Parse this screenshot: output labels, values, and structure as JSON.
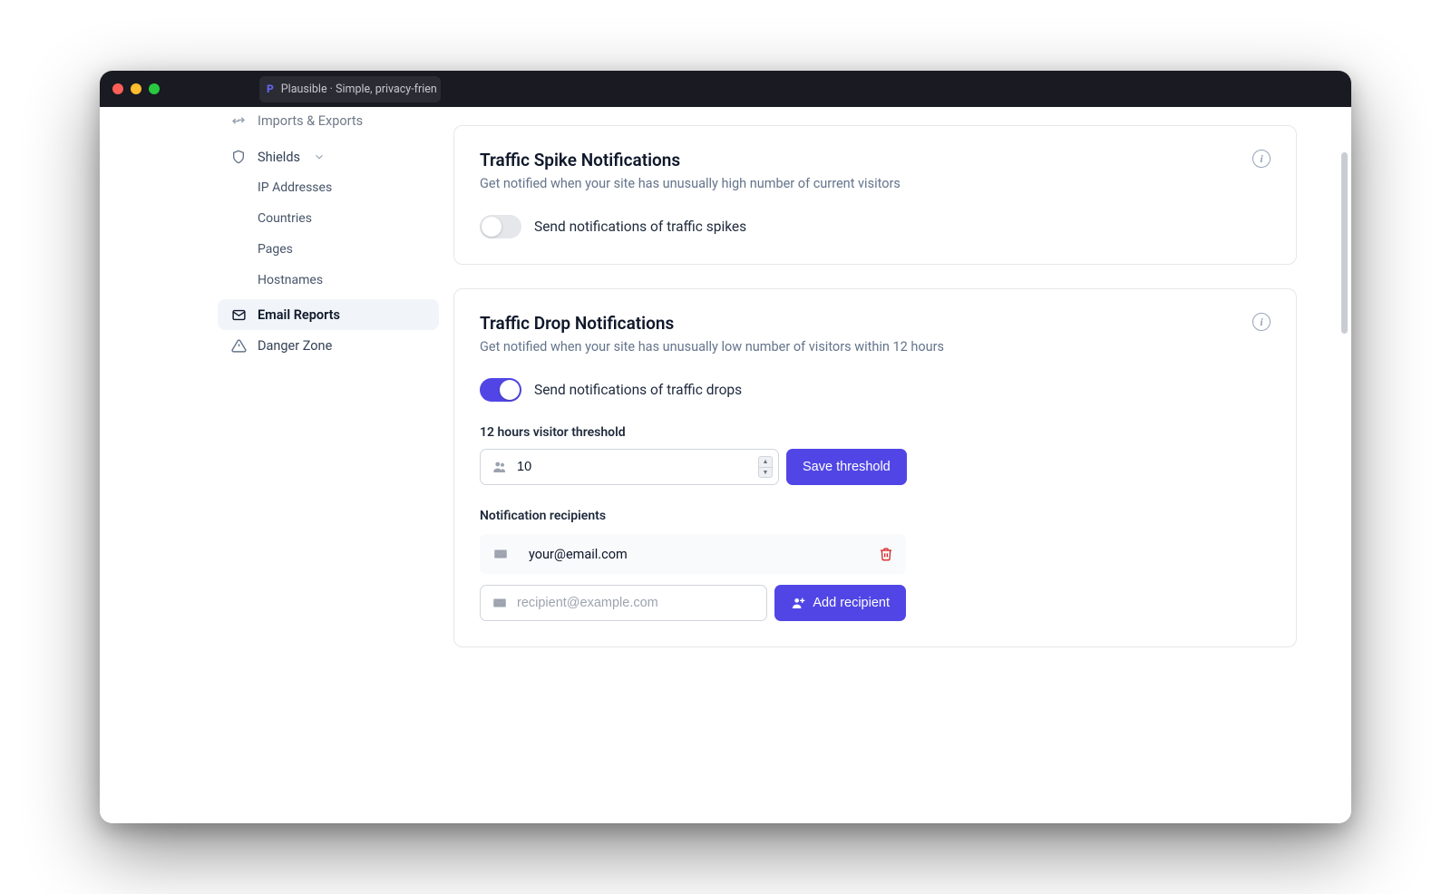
{
  "tab": {
    "title": "Plausible · Simple, privacy-frien",
    "favicon_letter": "P"
  },
  "sidebar": {
    "imports_exports": "Imports & Exports",
    "shields": {
      "label": "Shields",
      "items": [
        "IP Addresses",
        "Countries",
        "Pages",
        "Hostnames"
      ]
    },
    "email_reports": "Email Reports",
    "danger_zone": "Danger Zone"
  },
  "spike": {
    "title": "Traffic Spike Notifications",
    "desc": "Get notified when your site has unusually high number of current visitors",
    "toggle_label": "Send notifications of traffic spikes",
    "enabled": false
  },
  "drop": {
    "title": "Traffic Drop Notifications",
    "desc": "Get notified when your site has unusually low number of visitors within 12 hours",
    "toggle_label": "Send notifications of traffic drops",
    "enabled": true,
    "threshold_label": "12 hours visitor threshold",
    "threshold_value": "10",
    "save_btn": "Save threshold",
    "recipients_label": "Notification recipients",
    "recipients": [
      "your@email.com"
    ],
    "add_placeholder": "recipient@example.com",
    "add_btn": "Add recipient"
  }
}
